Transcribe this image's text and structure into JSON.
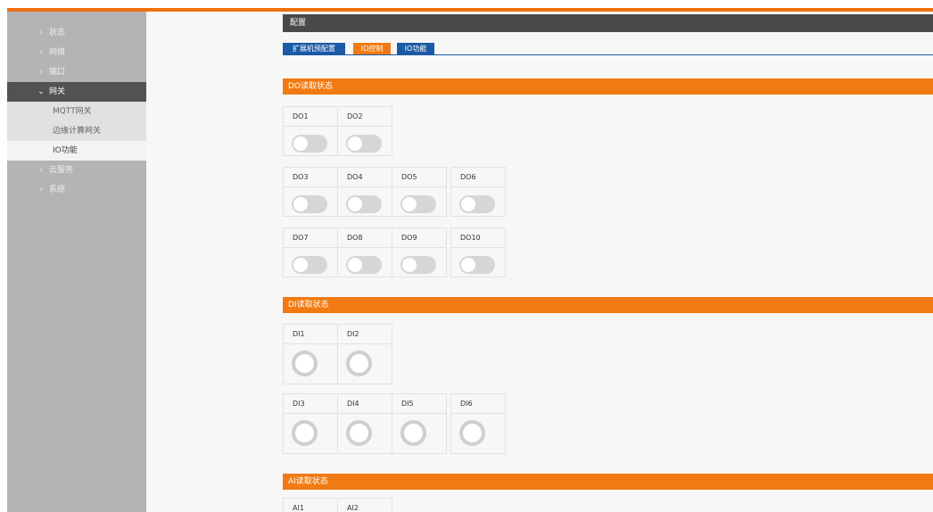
{
  "colors": {
    "accent": "#f17a12",
    "tab_blue": "#1c5aa6",
    "title_bar": "#494949",
    "sidebar": "#b4b4b4",
    "toggle_off": "#d6d6d6",
    "indicator_off": "#cfcfcf"
  },
  "sidebar": {
    "items": [
      {
        "label": "状态",
        "icon": "chevron-right-icon",
        "chev": "›"
      },
      {
        "label": "网络",
        "icon": "chevron-right-icon",
        "chev": "›"
      },
      {
        "label": "端口",
        "icon": "chevron-right-icon",
        "chev": "›"
      },
      {
        "label": "网关",
        "icon": "chevron-down-icon",
        "chev": "⌄"
      },
      {
        "label": "云服务",
        "icon": "chevron-right-icon",
        "chev": "›"
      },
      {
        "label": "系统",
        "icon": "chevron-right-icon",
        "chev": "›"
      }
    ],
    "subitems": [
      {
        "label": "MQTT网关"
      },
      {
        "label": "边缘计算网关"
      },
      {
        "label": "IO功能"
      }
    ]
  },
  "main": {
    "title": "配置",
    "tabs": [
      {
        "label": "扩展机预配置",
        "state": "inactive"
      },
      {
        "label": "IO控制",
        "state": "active"
      },
      {
        "label": "IO功能",
        "state": "inactive"
      }
    ]
  },
  "do_section": {
    "title": "DO读取状态",
    "items": [
      {
        "label": "DO1",
        "on": false
      },
      {
        "label": "DO2",
        "on": false
      },
      {
        "label": "DO3",
        "on": false
      },
      {
        "label": "DO4",
        "on": false
      },
      {
        "label": "DO5",
        "on": false
      },
      {
        "label": "DO6",
        "on": false
      },
      {
        "label": "DO7",
        "on": false
      },
      {
        "label": "DO8",
        "on": false
      },
      {
        "label": "DO9",
        "on": false
      },
      {
        "label": "DO10",
        "on": false
      }
    ]
  },
  "di_section": {
    "title": "DI读取状态",
    "items": [
      {
        "label": "DI1",
        "on": false
      },
      {
        "label": "DI2",
        "on": false
      },
      {
        "label": "DI3",
        "on": false
      },
      {
        "label": "DI4",
        "on": false
      },
      {
        "label": "DI5",
        "on": false
      },
      {
        "label": "DI6",
        "on": false
      }
    ]
  },
  "ai_section": {
    "title": "AI读取状态",
    "items": [
      {
        "label": "AI1"
      },
      {
        "label": "AI2"
      }
    ]
  }
}
